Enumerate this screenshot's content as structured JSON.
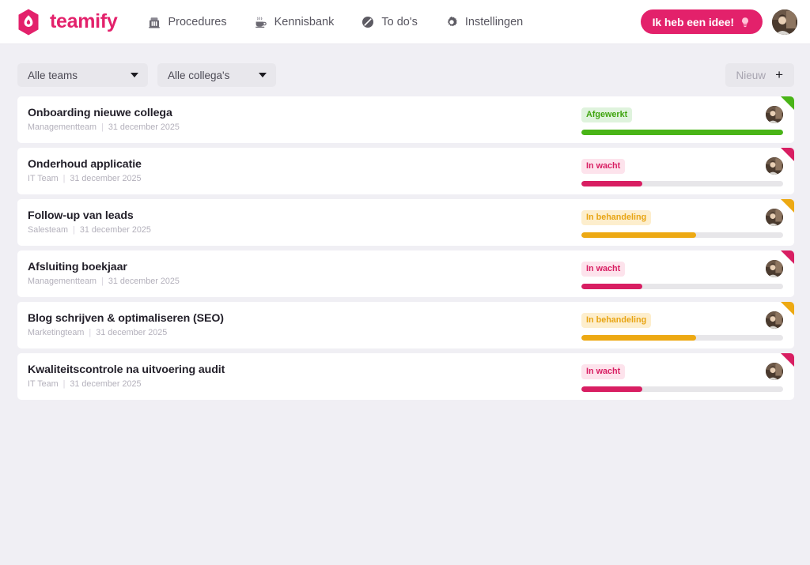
{
  "header": {
    "brand": {
      "name": "teamify",
      "logo_icon": "flame-hexagon-logo",
      "color": "#e3216b"
    },
    "nav": [
      {
        "label": "Procedures",
        "icon": "building-icon"
      },
      {
        "label": "Kennisbank",
        "icon": "coffee-cup-icon"
      },
      {
        "label": "To do's",
        "icon": "checklist-circle-icon"
      },
      {
        "label": "Instellingen",
        "icon": "gear-icon"
      }
    ],
    "idea_button": {
      "label": "Ik heb een idee!",
      "icon": "lightbulb-icon",
      "color": "#e3216b"
    },
    "avatar": {
      "icon": "user-avatar"
    }
  },
  "toolbar": {
    "team_filter": {
      "value": "Alle teams",
      "options": [
        "Alle teams"
      ]
    },
    "colleague_filter": {
      "value": "Alle collega's",
      "options": [
        "Alle collega's"
      ]
    },
    "new_button": {
      "label": "Nieuw",
      "icon": "plus-icon"
    }
  },
  "list": {
    "separator": "|",
    "items": [
      {
        "title": "Onboarding nieuwe collega",
        "team": "Managementteam",
        "date": "31 december 2025",
        "status": "Afgewerkt",
        "status_kind": "done",
        "progress": 100,
        "status_color": "#49b417"
      },
      {
        "title": "Onderhoud applicatie",
        "team": "IT Team",
        "date": "31 december 2025",
        "status": "In wacht",
        "status_kind": "waiting",
        "progress": 30,
        "status_color": "#d81e62"
      },
      {
        "title": "Follow-up van leads",
        "team": "Salesteam",
        "date": "31 december 2025",
        "status": "In behandeling",
        "status_kind": "progress",
        "progress": 57,
        "status_color": "#eda913"
      },
      {
        "title": "Afsluiting boekjaar",
        "team": "Managementteam",
        "date": "31 december 2025",
        "status": "In wacht",
        "status_kind": "waiting",
        "progress": 30,
        "status_color": "#d81e62"
      },
      {
        "title": "Blog schrijven & optimaliseren (SEO)",
        "team": "Marketingteam",
        "date": "31 december 2025",
        "status": "In behandeling",
        "status_kind": "progress",
        "progress": 57,
        "status_color": "#eda913"
      },
      {
        "title": "Kwaliteitscontrole na uitvoering audit",
        "team": "IT Team",
        "date": "31 december 2025",
        "status": "In wacht",
        "status_kind": "waiting",
        "progress": 30,
        "status_color": "#d81e62"
      }
    ]
  }
}
